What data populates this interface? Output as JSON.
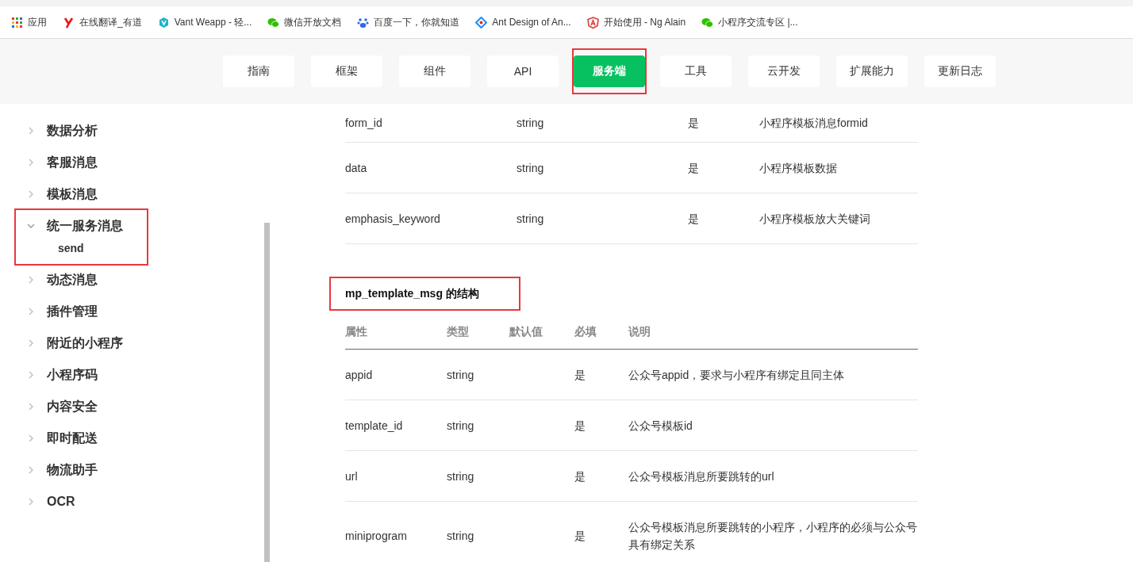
{
  "bookmarks": [
    {
      "kind": "apps",
      "label": "应用"
    },
    {
      "kind": "youdao",
      "label": "在线翻译_有道"
    },
    {
      "kind": "vant",
      "label": "Vant Weapp - 轻..."
    },
    {
      "kind": "wechat",
      "label": "微信开放文档"
    },
    {
      "kind": "baidu",
      "label": "百度一下，你就知道"
    },
    {
      "kind": "ant",
      "label": "Ant Design of An..."
    },
    {
      "kind": "angular",
      "label": "开始使用 - Ng Alain"
    },
    {
      "kind": "wechat",
      "label": "小程序交流专区 |..."
    }
  ],
  "nav_tabs": [
    {
      "label": "指南",
      "selected": false,
      "highlighted": false
    },
    {
      "label": "框架",
      "selected": false,
      "highlighted": false
    },
    {
      "label": "组件",
      "selected": false,
      "highlighted": false
    },
    {
      "label": "API",
      "selected": false,
      "highlighted": false
    },
    {
      "label": "服务端",
      "selected": true,
      "highlighted": true
    },
    {
      "label": "工具",
      "selected": false,
      "highlighted": false
    },
    {
      "label": "云开发",
      "selected": false,
      "highlighted": false
    },
    {
      "label": "扩展能力",
      "selected": false,
      "highlighted": false
    },
    {
      "label": "更新日志",
      "selected": false,
      "highlighted": false
    }
  ],
  "sidebar": {
    "items": [
      {
        "label": "数据分析",
        "expanded": false,
        "highlighted": false
      },
      {
        "label": "客服消息",
        "expanded": false,
        "highlighted": false
      },
      {
        "label": "模板消息",
        "expanded": false,
        "highlighted": false
      },
      {
        "label": "统一服务消息",
        "expanded": true,
        "highlighted": true,
        "children": [
          {
            "label": "send"
          }
        ]
      },
      {
        "label": "动态消息",
        "expanded": false,
        "highlighted": false
      },
      {
        "label": "插件管理",
        "expanded": false,
        "highlighted": false
      },
      {
        "label": "附近的小程序",
        "expanded": false,
        "highlighted": false
      },
      {
        "label": "小程序码",
        "expanded": false,
        "highlighted": false
      },
      {
        "label": "内容安全",
        "expanded": false,
        "highlighted": false
      },
      {
        "label": "即时配送",
        "expanded": false,
        "highlighted": false
      },
      {
        "label": "物流助手",
        "expanded": false,
        "highlighted": false
      },
      {
        "label": "OCR",
        "expanded": false,
        "highlighted": false
      }
    ]
  },
  "table_1": {
    "rows": [
      [
        "form_id",
        "string",
        "是",
        "小程序模板消息formid"
      ],
      [
        "data",
        "string",
        "是",
        "小程序模板数据"
      ],
      [
        "emphasis_keyword",
        "string",
        "是",
        "小程序模板放大关键词"
      ]
    ]
  },
  "section": {
    "heading": "mp_template_msg 的结构",
    "highlighted": true
  },
  "table_2": {
    "columns": [
      "属性",
      "类型",
      "默认值",
      "必填",
      "说明"
    ],
    "rows": [
      [
        "appid",
        "string",
        "",
        "是",
        "公众号appid，要求与小程序有绑定且同主体"
      ],
      [
        "template_id",
        "string",
        "",
        "是",
        "公众号模板id"
      ],
      [
        "url",
        "string",
        "",
        "是",
        "公众号模板消息所要跳转的url"
      ],
      [
        "miniprogram",
        "string",
        "",
        "是",
        "公众号模板消息所要跳转的小程序，小程序的必须与公众号具有绑定关系"
      ]
    ]
  }
}
